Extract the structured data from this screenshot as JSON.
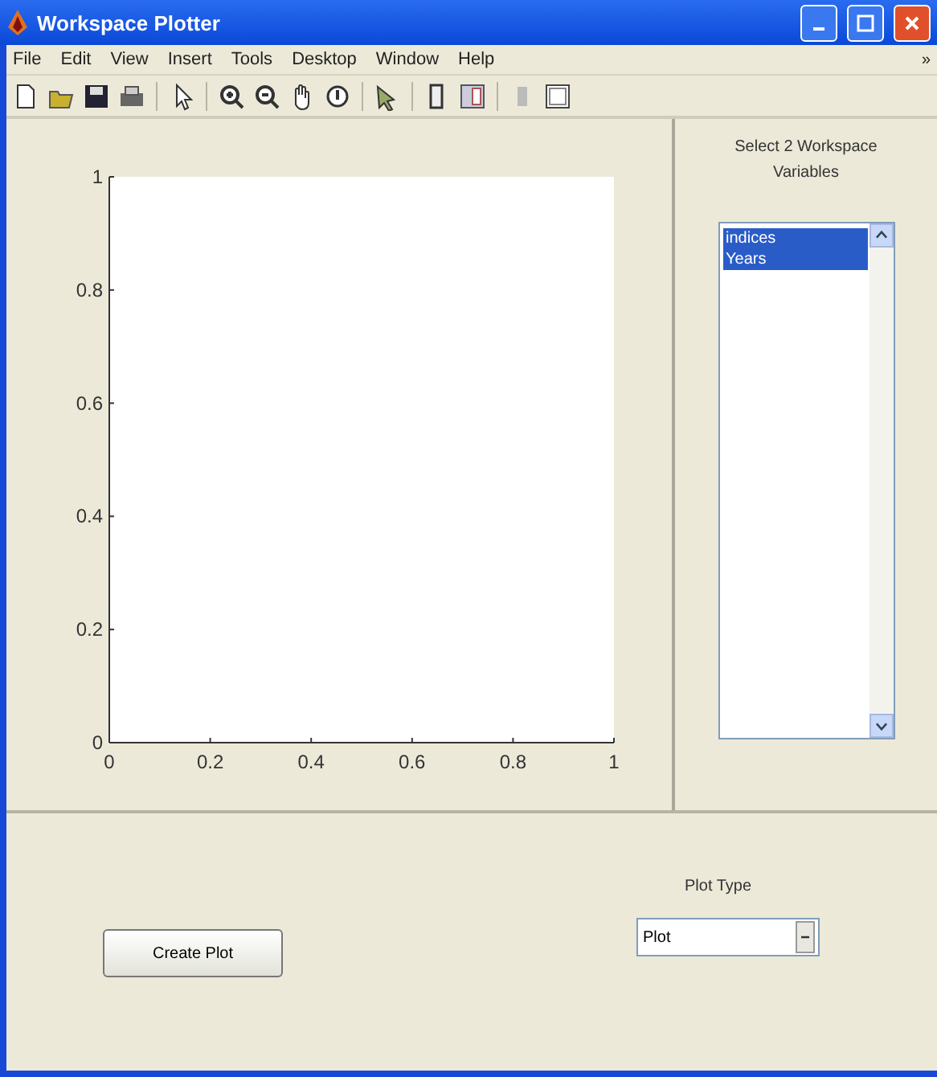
{
  "window": {
    "title": "Workspace Plotter"
  },
  "menu": [
    "File",
    "Edit",
    "View",
    "Insert",
    "Tools",
    "Desktop",
    "Window",
    "Help"
  ],
  "menu_overflow": "»",
  "plot_panel": {
    "chart_data": {
      "type": "line",
      "xlim": [
        0,
        1
      ],
      "ylim": [
        0,
        1
      ],
      "xticks": [
        {
          "value": 0,
          "label": "0"
        },
        {
          "value": 0.2,
          "label": "0.2"
        },
        {
          "value": 0.4,
          "label": "0.4"
        },
        {
          "value": 0.6,
          "label": "0.6"
        },
        {
          "value": 0.8,
          "label": "0.8"
        },
        {
          "value": 1,
          "label": "1"
        }
      ],
      "yticks": [
        {
          "value": 0,
          "label": "0"
        },
        {
          "value": 0.2,
          "label": "0.2"
        },
        {
          "value": 0.4,
          "label": "0.4"
        },
        {
          "value": 0.6,
          "label": "0.6"
        },
        {
          "value": 0.8,
          "label": "0.8"
        },
        {
          "value": 1,
          "label": "1"
        }
      ]
    }
  },
  "variables_panel": {
    "title_lines": [
      "Select 2 Workspace",
      "Variables"
    ],
    "items": [
      {
        "label": "indices",
        "selected": true
      },
      {
        "label": "Years",
        "selected": true
      }
    ]
  },
  "bottom_panel": {
    "create_button": "Create Plot",
    "plot_type_label": "Plot Type",
    "plot_type_value": "Plot"
  }
}
